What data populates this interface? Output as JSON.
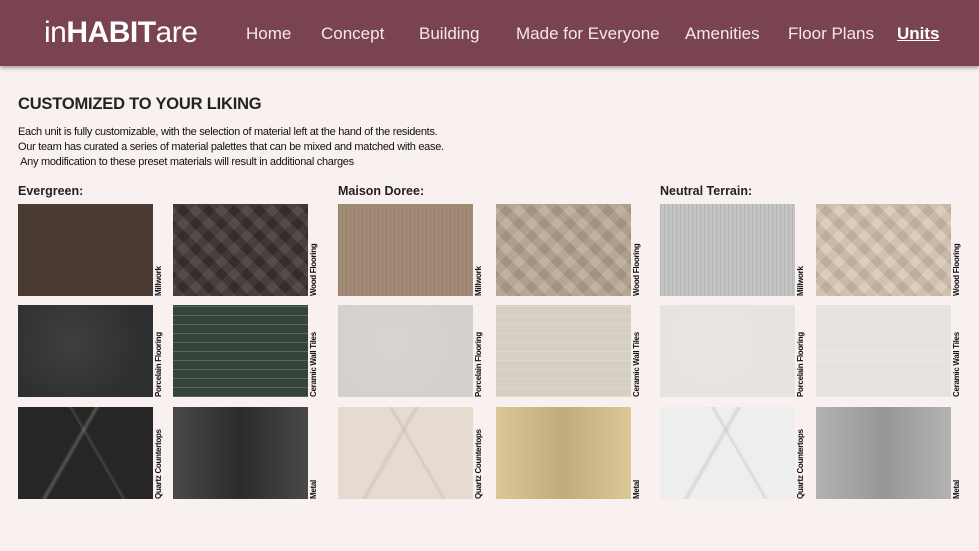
{
  "brand": {
    "prefix": "in",
    "bold": "HABIT",
    "suffix": "are"
  },
  "nav": [
    {
      "label": "Home"
    },
    {
      "label": "Concept"
    },
    {
      "label": "Building"
    },
    {
      "label": "Made for Everyone"
    },
    {
      "label": "Amenities"
    },
    {
      "label": "Floor Plans"
    },
    {
      "label": "Units",
      "active": true
    }
  ],
  "page": {
    "heading": "CUSTOMIZED TO YOUR LIKING",
    "intro": [
      "Each unit is fully customizable, with the selection of material left at the hand of the residents.",
      "Our team has curated a series of material palettes that can be mixed and matched with ease.",
      " Any modification to these preset materials will result in additional charges"
    ]
  },
  "palettes": [
    {
      "name": "Evergreen:",
      "materials": [
        {
          "label": "Millwork",
          "color": "#4a3c32"
        },
        {
          "label": "Wood Flooring",
          "color": "#3d3230"
        },
        {
          "label": "Porcelain Flooring",
          "color": "#2d2f31"
        },
        {
          "label": "Ceramic Wall Tiles",
          "color": "#344438"
        },
        {
          "label": "Quartz Countertops",
          "color": "#262626"
        },
        {
          "label": "Metal",
          "color": "#303030"
        }
      ]
    },
    {
      "name": "Maison Doree:",
      "materials": [
        {
          "label": "Millwork",
          "color": "#a28c76"
        },
        {
          "label": "Wood Flooring",
          "color": "#b9a693"
        },
        {
          "label": "Porcelain Flooring",
          "color": "#d4d0cd"
        },
        {
          "label": "Ceramic Wall Tiles",
          "color": "#d6d0c4"
        },
        {
          "label": "Quartz Countertops",
          "color": "#e6dbd0"
        },
        {
          "label": "Metal",
          "color": "#d6c088"
        }
      ]
    },
    {
      "name": "Neutral Terrain:",
      "materials": [
        {
          "label": "Millwork",
          "color": "#c4c4c4"
        },
        {
          "label": "Wood Flooring",
          "color": "#d7c6b2"
        },
        {
          "label": "Porcelain Flooring",
          "color": "#e6e3e0"
        },
        {
          "label": "Ceramic Wall Tiles",
          "color": "#e6e2df"
        },
        {
          "label": "Quartz Countertops",
          "color": "#eeeeee"
        },
        {
          "label": "Metal",
          "color": "#a8a8a8"
        }
      ]
    }
  ]
}
